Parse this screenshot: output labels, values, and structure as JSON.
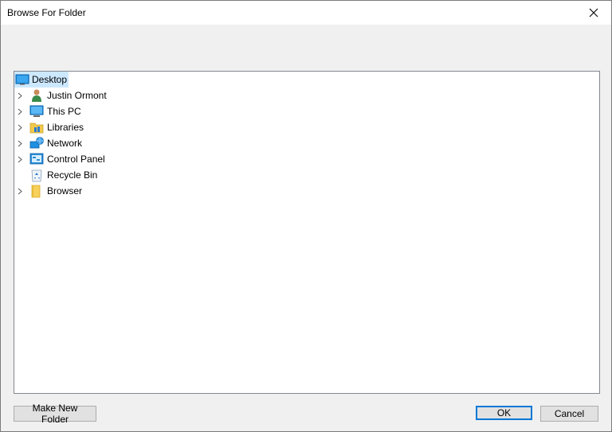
{
  "window": {
    "title": "Browse For Folder"
  },
  "tree": {
    "root": {
      "label": "Desktop",
      "icon": "desktop-icon",
      "selected": true
    },
    "items": [
      {
        "label": "Justin Ormont",
        "icon": "user-icon",
        "expandable": true
      },
      {
        "label": "This PC",
        "icon": "computer-icon",
        "expandable": true
      },
      {
        "label": "Libraries",
        "icon": "libraries-icon",
        "expandable": true
      },
      {
        "label": "Network",
        "icon": "network-icon",
        "expandable": true
      },
      {
        "label": "Control Panel",
        "icon": "control-panel-icon",
        "expandable": true
      },
      {
        "label": "Recycle Bin",
        "icon": "recycle-bin-icon",
        "expandable": false
      },
      {
        "label": "Browser",
        "icon": "folder-icon",
        "expandable": true
      }
    ]
  },
  "buttons": {
    "make_new_folder": "Make New Folder",
    "ok": "OK",
    "cancel": "Cancel"
  },
  "colors": {
    "selection": "#cce8ff",
    "default_button_border": "#0078d7"
  }
}
